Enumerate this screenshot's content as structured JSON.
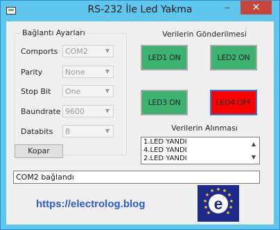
{
  "window": {
    "title": "RS-232 İle Led Yakma",
    "min_label": "‒",
    "max_label": "☐",
    "close_label": "✕"
  },
  "connection": {
    "group_title": "Bağlantı Ayarları",
    "fields": [
      {
        "label": "Comports",
        "value": "COM2"
      },
      {
        "label": "Parity",
        "value": "None"
      },
      {
        "label": "Stop Bit",
        "value": "One"
      },
      {
        "label": "Baundrate",
        "value": "9600"
      },
      {
        "label": "Databits",
        "value": "8"
      }
    ]
  },
  "send": {
    "title": "Verilerin Gönderilmesi",
    "leds": [
      {
        "label": "LED1 ON",
        "color": "#3cb371"
      },
      {
        "label": "LED2 ON",
        "color": "#3cb371"
      },
      {
        "label": "LED3 ON",
        "color": "#3cb371"
      },
      {
        "label": "LED4 OFF",
        "color": "#ff0000"
      }
    ]
  },
  "receive": {
    "title": "Verilerin Alınması",
    "items": [
      "1.LED YANDI",
      "4.LED YANDI",
      "2.LED YANDI"
    ]
  },
  "kopar_label": "Kopar",
  "status": "COM2 bağlandı",
  "website": "https://electrolog.blog",
  "logo_letter": "e"
}
